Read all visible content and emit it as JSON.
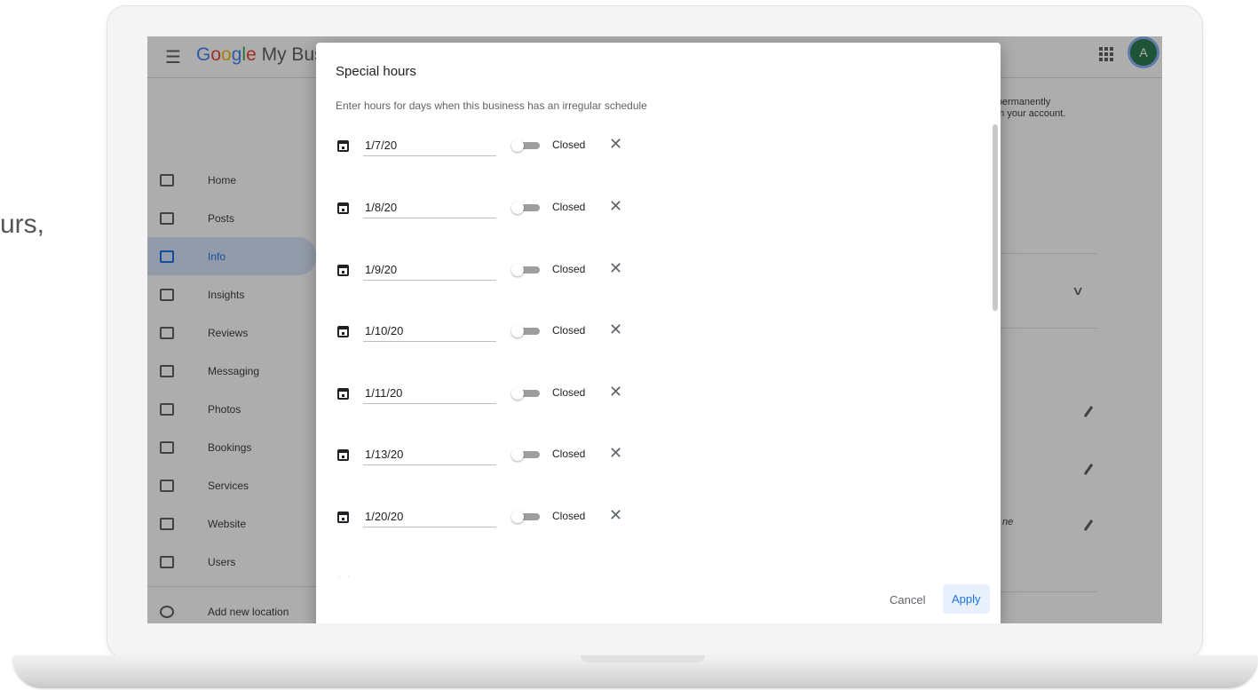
{
  "outside": {
    "left_text": "urs,"
  },
  "header": {
    "logo_text": "My Busi",
    "avatar_letter": "A"
  },
  "sidebar": {
    "items": [
      {
        "label": "Home"
      },
      {
        "label": "Posts"
      },
      {
        "label": "Info"
      },
      {
        "label": "Insights"
      },
      {
        "label": "Reviews"
      },
      {
        "label": "Messaging"
      },
      {
        "label": "Photos"
      },
      {
        "label": "Bookings"
      },
      {
        "label": "Services"
      },
      {
        "label": "Website"
      },
      {
        "label": "Users"
      }
    ],
    "add_location": "Add new location"
  },
  "background": {
    "right_line1": "r permanently",
    "right_line2": "om your account.",
    "italic_fragment": "ne"
  },
  "dialog": {
    "title": "Special hours",
    "subtitle": "Enter hours for days when this business has an irregular schedule",
    "rows": [
      {
        "date": "1/7/20",
        "status": "Closed"
      },
      {
        "date": "1/8/20",
        "status": "Closed"
      },
      {
        "date": "1/9/20",
        "status": "Closed"
      },
      {
        "date": "1/10/20",
        "status": "Closed"
      },
      {
        "date": "1/11/20",
        "status": "Closed"
      },
      {
        "date": "1/13/20",
        "status": "Closed"
      },
      {
        "date": "1/20/20",
        "status": "Closed"
      }
    ],
    "cancel_label": "Cancel",
    "apply_label": "Apply"
  }
}
